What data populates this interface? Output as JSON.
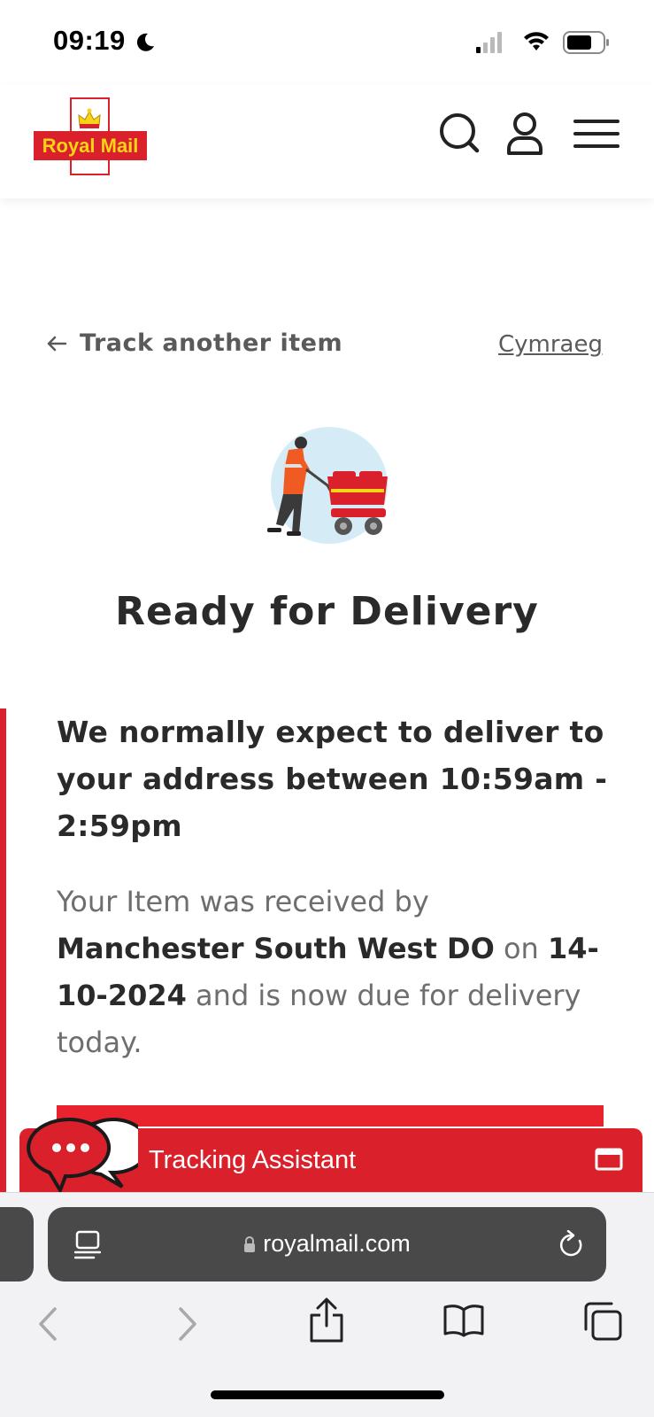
{
  "status_bar": {
    "time": "09:19",
    "icons": [
      "moon-icon",
      "cellular-signal-icon",
      "wifi-icon",
      "battery-icon"
    ]
  },
  "header": {
    "logo_text": "Royal Mail",
    "icons": [
      "search-icon",
      "account-icon",
      "menu-icon"
    ]
  },
  "navigation": {
    "back_label": "Track another item",
    "language_label": "Cymraeg"
  },
  "tracking": {
    "status_title": "Ready for Delivery",
    "expectation": "We normally expect to deliver to your address between 10:59am - 2:59pm",
    "received_prefix": "Your Item was received by ",
    "office": "Manchester South West DO",
    "on_word": " on ",
    "date": "14-10-2024",
    "received_suffix": " and is now due for delivery today."
  },
  "assistant": {
    "label": "Tracking Assistant"
  },
  "browser": {
    "url": "royalmail.com",
    "toolbar": [
      "back-icon",
      "forward-icon",
      "share-icon",
      "bookmarks-icon",
      "tabs-icon"
    ]
  },
  "colors": {
    "brand_red": "#da202a",
    "brand_yellow": "#f7d417",
    "text_dark": "#2a2a2a",
    "text_muted": "#6e6e6e",
    "url_bar": "#4a4949"
  }
}
